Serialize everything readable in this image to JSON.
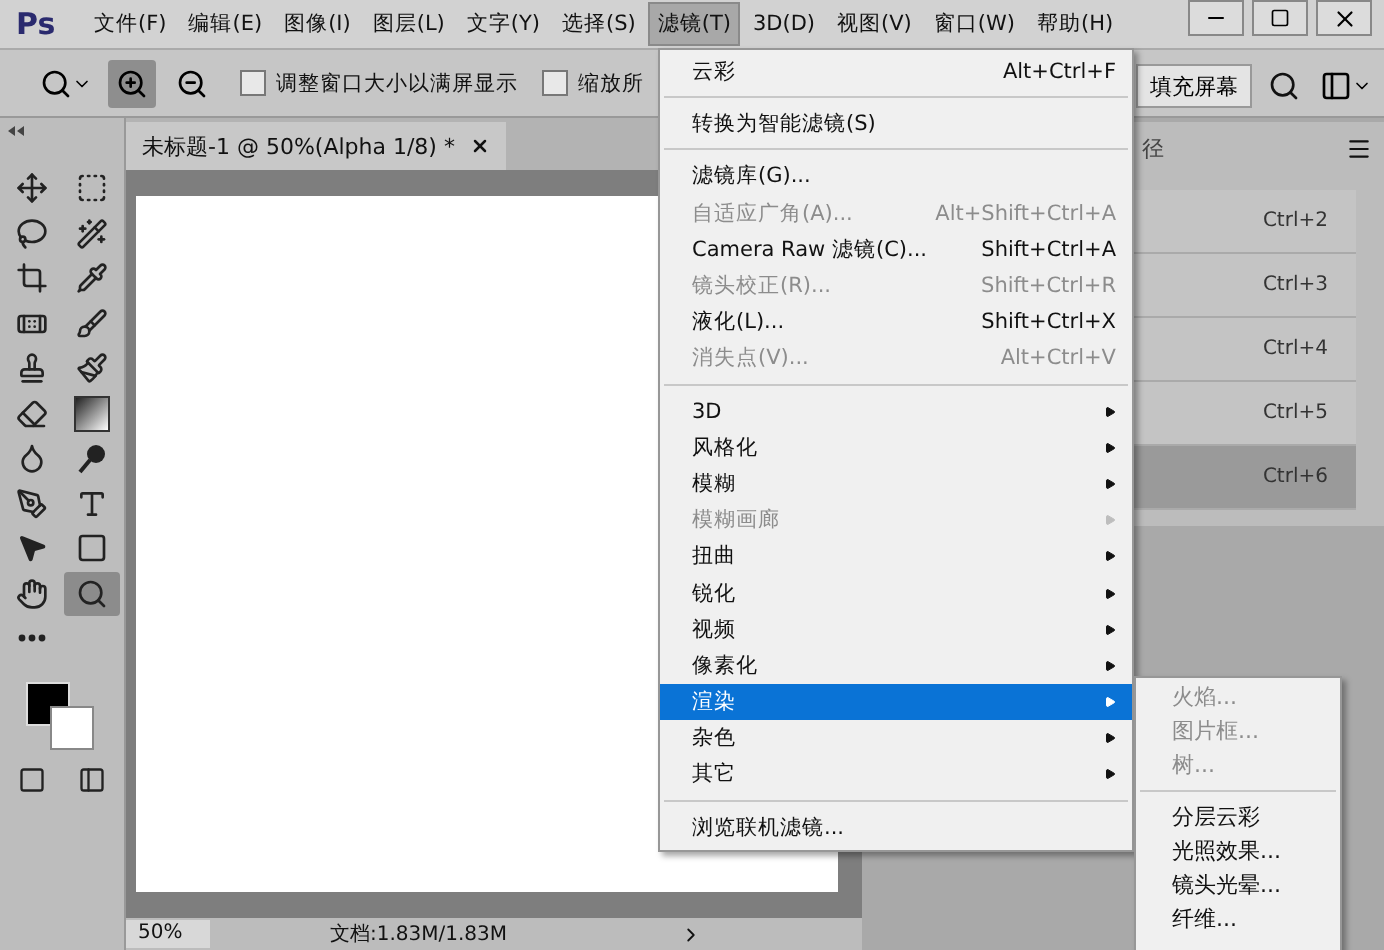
{
  "app_logo": "Ps",
  "menu_bar": [
    {
      "label": "文件(F)",
      "selected": false
    },
    {
      "label": "编辑(E)",
      "selected": false
    },
    {
      "label": "图像(I)",
      "selected": false
    },
    {
      "label": "图层(L)",
      "selected": false
    },
    {
      "label": "文字(Y)",
      "selected": false
    },
    {
      "label": "选择(S)",
      "selected": false
    },
    {
      "label": "滤镜(T)",
      "selected": true
    },
    {
      "label": "3D(D)",
      "selected": false
    },
    {
      "label": "视图(V)",
      "selected": false
    },
    {
      "label": "窗口(W)",
      "selected": false
    },
    {
      "label": "帮助(H)",
      "selected": false
    }
  ],
  "options_bar": {
    "zoom_buttons": [
      {
        "kind": "zoom-in",
        "selected": true
      },
      {
        "kind": "zoom-out",
        "selected": false
      }
    ],
    "checkboxes": [
      {
        "label": "调整窗口大小以满屏显示",
        "checked": false
      },
      {
        "label": "缩放所",
        "checked": false
      }
    ],
    "fill_screen_button": "填充屏幕"
  },
  "tools": [
    {
      "kind": "move",
      "selected": false
    },
    {
      "kind": "marquee",
      "selected": false
    },
    {
      "kind": "lasso",
      "selected": false
    },
    {
      "kind": "wand",
      "selected": false
    },
    {
      "kind": "crop",
      "selected": false
    },
    {
      "kind": "eyedropper",
      "selected": false
    },
    {
      "kind": "heal",
      "selected": false
    },
    {
      "kind": "brush",
      "selected": false
    },
    {
      "kind": "stamp",
      "selected": false
    },
    {
      "kind": "history-brush",
      "selected": false
    },
    {
      "kind": "eraser",
      "selected": false
    },
    {
      "kind": "gradient",
      "selected": false
    },
    {
      "kind": "blur",
      "selected": false
    },
    {
      "kind": "dodge",
      "selected": false
    },
    {
      "kind": "pen",
      "selected": false
    },
    {
      "kind": "type",
      "selected": false
    },
    {
      "kind": "select",
      "selected": false
    },
    {
      "kind": "rectangle",
      "selected": false
    },
    {
      "kind": "hand",
      "selected": false
    },
    {
      "kind": "zoom",
      "selected": true
    },
    {
      "kind": "more",
      "selected": false
    }
  ],
  "document_tab": {
    "title": "未标题-1 @ 50%(Alpha 1/8) *"
  },
  "status_bar": {
    "zoom": "50%",
    "doc_info": "文档:1.83M/1.83M"
  },
  "panel": {
    "tab": "径",
    "rows": [
      {
        "shortcut": "Ctrl+2",
        "selected": false
      },
      {
        "shortcut": "Ctrl+3",
        "selected": false
      },
      {
        "shortcut": "Ctrl+4",
        "selected": false
      },
      {
        "shortcut": "Ctrl+5",
        "selected": false
      },
      {
        "shortcut": "Ctrl+6",
        "selected": true
      }
    ]
  },
  "filter_menu": [
    {
      "kind": "item",
      "label": "云彩",
      "shortcut": "Alt+Ctrl+F",
      "disabled": false,
      "submenu": false,
      "selected": false
    },
    {
      "kind": "separator"
    },
    {
      "kind": "item",
      "label": "转换为智能滤镜(S)",
      "disabled": false,
      "submenu": false,
      "selected": false
    },
    {
      "kind": "separator"
    },
    {
      "kind": "item",
      "label": "滤镜库(G)...",
      "disabled": false,
      "submenu": false,
      "selected": false
    },
    {
      "kind": "item",
      "label": "自适应广角(A)...",
      "shortcut": "Alt+Shift+Ctrl+A",
      "disabled": true,
      "submenu": false,
      "selected": false
    },
    {
      "kind": "item",
      "label": "Camera Raw 滤镜(C)...",
      "shortcut": "Shift+Ctrl+A",
      "disabled": false,
      "submenu": false,
      "selected": false
    },
    {
      "kind": "item",
      "label": "镜头校正(R)...",
      "shortcut": "Shift+Ctrl+R",
      "disabled": true,
      "submenu": false,
      "selected": false
    },
    {
      "kind": "item",
      "label": "液化(L)...",
      "shortcut": "Shift+Ctrl+X",
      "disabled": false,
      "submenu": false,
      "selected": false
    },
    {
      "kind": "item",
      "label": "消失点(V)...",
      "shortcut": "Alt+Ctrl+V",
      "disabled": true,
      "submenu": false,
      "selected": false
    },
    {
      "kind": "separator"
    },
    {
      "kind": "item",
      "label": "3D",
      "disabled": false,
      "submenu": true,
      "selected": false
    },
    {
      "kind": "item",
      "label": "风格化",
      "disabled": false,
      "submenu": true,
      "selected": false
    },
    {
      "kind": "item",
      "label": "模糊",
      "disabled": false,
      "submenu": true,
      "selected": false
    },
    {
      "kind": "item",
      "label": "模糊画廊",
      "disabled": true,
      "submenu": true,
      "selected": false
    },
    {
      "kind": "item",
      "label": "扭曲",
      "disabled": false,
      "submenu": true,
      "selected": false
    },
    {
      "kind": "item",
      "label": "锐化",
      "disabled": false,
      "submenu": true,
      "selected": false
    },
    {
      "kind": "item",
      "label": "视频",
      "disabled": false,
      "submenu": true,
      "selected": false
    },
    {
      "kind": "item",
      "label": "像素化",
      "disabled": false,
      "submenu": true,
      "selected": false
    },
    {
      "kind": "item",
      "label": "渲染",
      "disabled": false,
      "submenu": true,
      "selected": true
    },
    {
      "kind": "item",
      "label": "杂色",
      "disabled": false,
      "submenu": true,
      "selected": false
    },
    {
      "kind": "item",
      "label": "其它",
      "disabled": false,
      "submenu": true,
      "selected": false
    },
    {
      "kind": "separator"
    },
    {
      "kind": "item",
      "label": "浏览联机滤镜...",
      "disabled": false,
      "submenu": false,
      "selected": false
    }
  ],
  "render_submenu": [
    {
      "kind": "item",
      "label": "火焰...",
      "disabled": true
    },
    {
      "kind": "item",
      "label": "图片框...",
      "disabled": true
    },
    {
      "kind": "item",
      "label": "树...",
      "disabled": true
    },
    {
      "kind": "separator"
    },
    {
      "kind": "item",
      "label": "分层云彩",
      "disabled": false
    },
    {
      "kind": "item",
      "label": "光照效果...",
      "disabled": false
    },
    {
      "kind": "item",
      "label": "镜头光晕...",
      "disabled": false
    },
    {
      "kind": "item",
      "label": "纤维...",
      "disabled": false
    }
  ]
}
